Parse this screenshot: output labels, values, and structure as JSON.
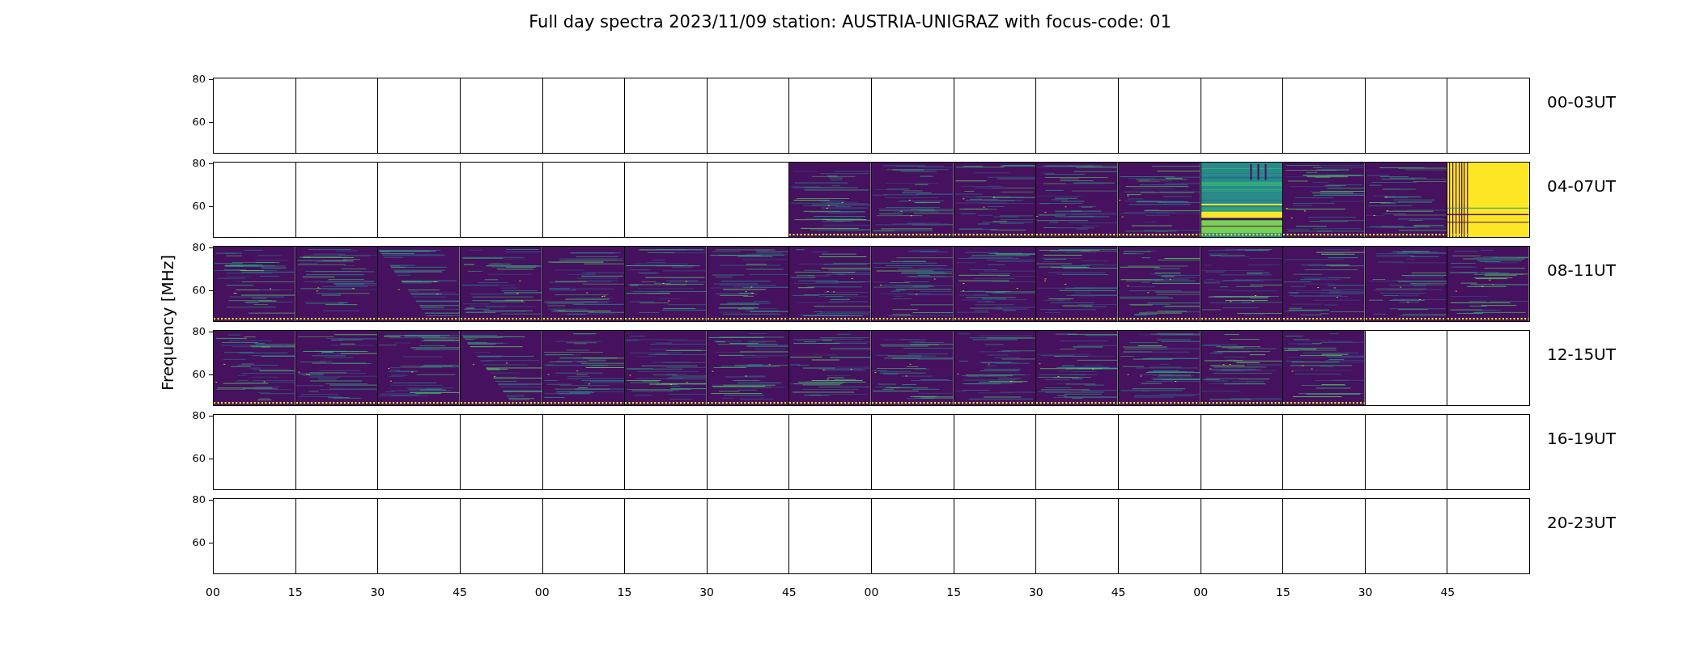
{
  "title": "Full day spectra 2023/11/09 station: AUSTRIA-UNIGRAZ with focus-code: 01",
  "y_axis": {
    "label": "Frequency [MHz]"
  },
  "rows": [
    {
      "label": "00-03UT",
      "yticks": [
        "80",
        "60"
      ],
      "panels": [
        {
          "kind": "blank"
        },
        {
          "kind": "blank"
        },
        {
          "kind": "blank"
        },
        {
          "kind": "blank"
        },
        {
          "kind": "blank"
        },
        {
          "kind": "blank"
        },
        {
          "kind": "blank"
        },
        {
          "kind": "blank"
        },
        {
          "kind": "blank"
        },
        {
          "kind": "blank"
        },
        {
          "kind": "blank"
        },
        {
          "kind": "blank"
        },
        {
          "kind": "blank"
        },
        {
          "kind": "blank"
        },
        {
          "kind": "blank"
        },
        {
          "kind": "blank"
        }
      ]
    },
    {
      "label": "04-07UT",
      "yticks": [
        "80",
        "60"
      ],
      "panels": [
        {
          "kind": "blank"
        },
        {
          "kind": "blank"
        },
        {
          "kind": "blank"
        },
        {
          "kind": "blank"
        },
        {
          "kind": "blank"
        },
        {
          "kind": "blank"
        },
        {
          "kind": "blank"
        },
        {
          "kind": "spectrogram"
        },
        {
          "kind": "spectrogram"
        },
        {
          "kind": "spectrogram"
        },
        {
          "kind": "spectrogram"
        },
        {
          "kind": "spectrogram"
        },
        {
          "kind": "bright"
        },
        {
          "kind": "spectrogram"
        },
        {
          "kind": "spectrogram"
        },
        {
          "kind": "saturated"
        }
      ]
    },
    {
      "label": "08-11UT",
      "yticks": [
        "80",
        "60"
      ],
      "panels": [
        {
          "kind": "spectrogram"
        },
        {
          "kind": "spectrogram"
        },
        {
          "kind": "spectrogram"
        },
        {
          "kind": "spectrogram"
        },
        {
          "kind": "spectrogram"
        },
        {
          "kind": "spectrogram"
        },
        {
          "kind": "spectrogram"
        },
        {
          "kind": "spectrogram"
        },
        {
          "kind": "spectrogram"
        },
        {
          "kind": "spectrogram"
        },
        {
          "kind": "spectrogram"
        },
        {
          "kind": "spectrogram"
        },
        {
          "kind": "spectrogram"
        },
        {
          "kind": "spectrogram"
        },
        {
          "kind": "spectrogram"
        },
        {
          "kind": "spectrogram"
        }
      ]
    },
    {
      "label": "12-15UT",
      "yticks": [
        "80",
        "60"
      ],
      "panels": [
        {
          "kind": "spectrogram"
        },
        {
          "kind": "spectrogram"
        },
        {
          "kind": "spectrogram"
        },
        {
          "kind": "spectrogram"
        },
        {
          "kind": "spectrogram"
        },
        {
          "kind": "spectrogram"
        },
        {
          "kind": "spectrogram"
        },
        {
          "kind": "spectrogram"
        },
        {
          "kind": "spectrogram"
        },
        {
          "kind": "spectrogram"
        },
        {
          "kind": "spectrogram"
        },
        {
          "kind": "spectrogram"
        },
        {
          "kind": "spectrogram"
        },
        {
          "kind": "spectrogram"
        },
        {
          "kind": "blank"
        },
        {
          "kind": "blank"
        }
      ]
    },
    {
      "label": "16-19UT",
      "yticks": [
        "80",
        "60"
      ],
      "panels": [
        {
          "kind": "blank"
        },
        {
          "kind": "blank"
        },
        {
          "kind": "blank"
        },
        {
          "kind": "blank"
        },
        {
          "kind": "blank"
        },
        {
          "kind": "blank"
        },
        {
          "kind": "blank"
        },
        {
          "kind": "blank"
        },
        {
          "kind": "blank"
        },
        {
          "kind": "blank"
        },
        {
          "kind": "blank"
        },
        {
          "kind": "blank"
        },
        {
          "kind": "blank"
        },
        {
          "kind": "blank"
        },
        {
          "kind": "blank"
        },
        {
          "kind": "blank"
        }
      ]
    },
    {
      "label": "20-23UT",
      "yticks": [
        "80",
        "60"
      ],
      "panels": [
        {
          "kind": "blank"
        },
        {
          "kind": "blank"
        },
        {
          "kind": "blank"
        },
        {
          "kind": "blank"
        },
        {
          "kind": "blank"
        },
        {
          "kind": "blank"
        },
        {
          "kind": "blank"
        },
        {
          "kind": "blank"
        },
        {
          "kind": "blank"
        },
        {
          "kind": "blank"
        },
        {
          "kind": "blank"
        },
        {
          "kind": "blank"
        },
        {
          "kind": "blank"
        },
        {
          "kind": "blank"
        },
        {
          "kind": "blank"
        },
        {
          "kind": "blank"
        }
      ]
    }
  ],
  "x_ticks": [
    "00",
    "15",
    "30",
    "45",
    "00",
    "15",
    "30",
    "45",
    "00",
    "15",
    "30",
    "45",
    "00",
    "15",
    "30",
    "45"
  ]
}
